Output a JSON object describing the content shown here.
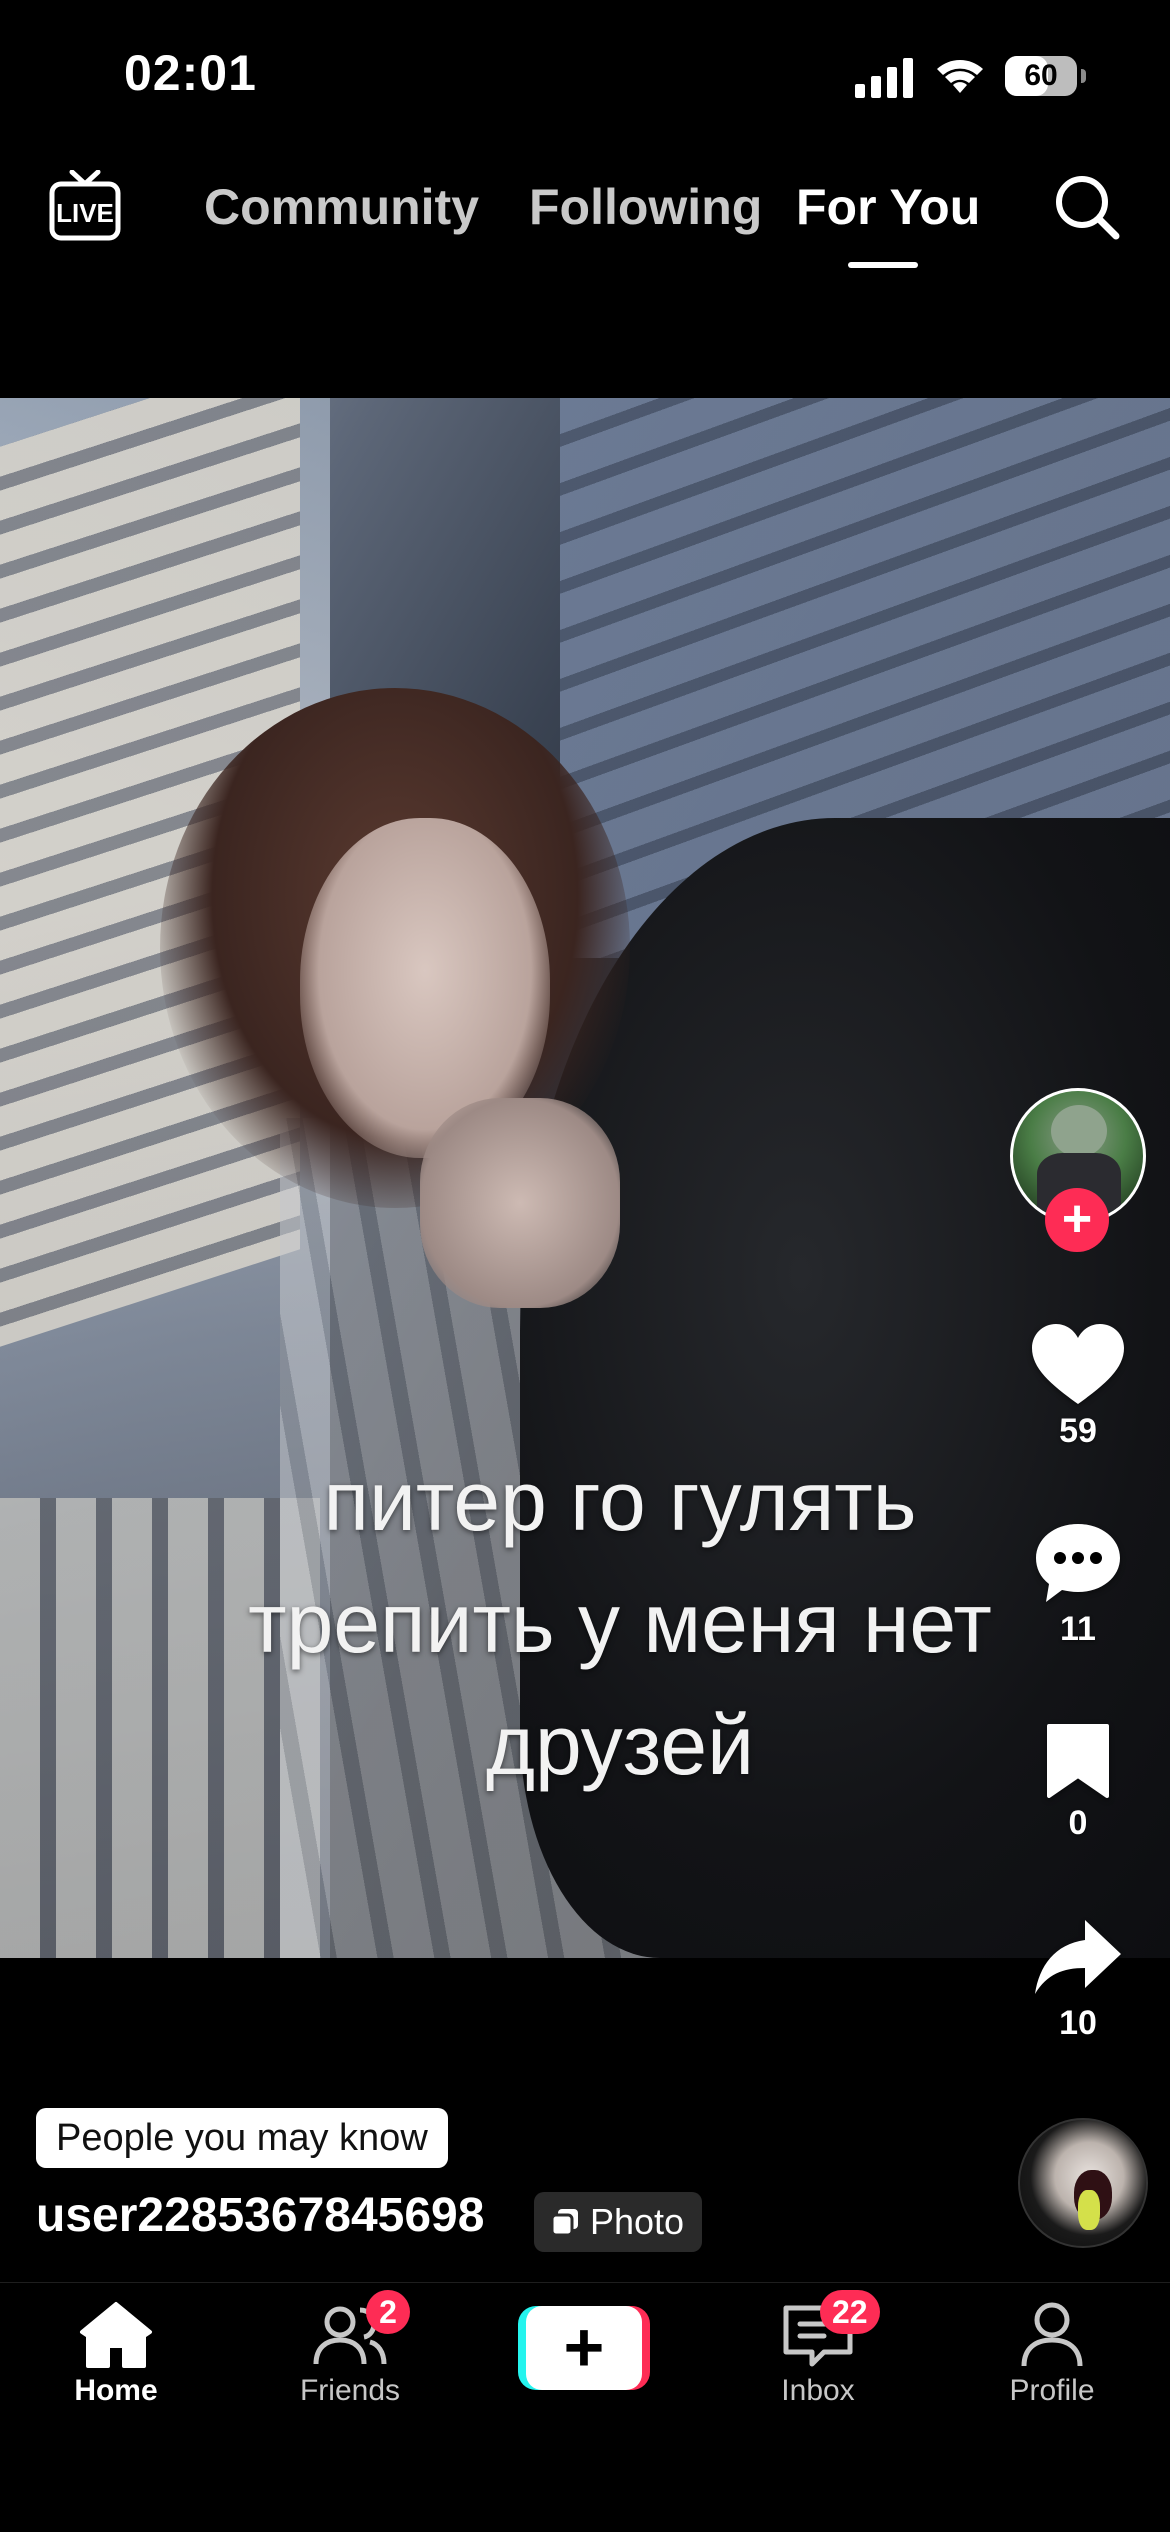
{
  "status_bar": {
    "time": "02:01",
    "battery": "60",
    "battery_level": 0.6
  },
  "top_nav": {
    "tabs": [
      "Community",
      "Following",
      "For You"
    ],
    "active_tab": "For You",
    "live_icon": "live-tv-icon",
    "search_icon": "search-icon"
  },
  "post": {
    "overlay_lines": [
      "питер го гулять",
      "трепить у меня нет",
      "друзей"
    ],
    "likes": "59",
    "comments": "11",
    "saves": "0",
    "shares": "10",
    "suggestion_label": "People you may know",
    "username": "user2285367845698",
    "content_type_label": "Photo"
  },
  "tabbar": {
    "home": "Home",
    "friends": "Friends",
    "friends_badge": "2",
    "inbox": "Inbox",
    "inbox_badge": "22",
    "profile": "Profile",
    "create_symbol": "+"
  },
  "colors": {
    "accent": "#fe2c55",
    "cyan": "#25f4ee",
    "background": "#000000"
  }
}
